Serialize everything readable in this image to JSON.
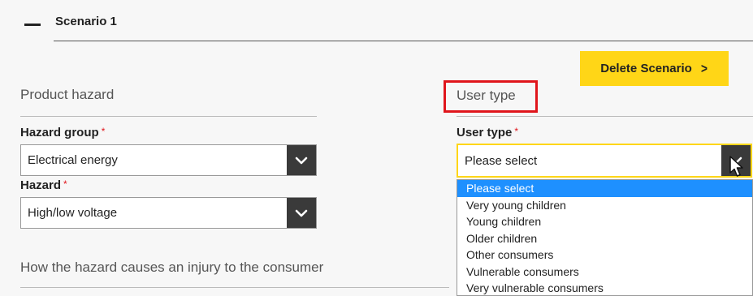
{
  "scenario": {
    "title": "Scenario 1"
  },
  "actions": {
    "delete_label": "Delete Scenario",
    "delete_icon": "chevron-right-icon"
  },
  "product_hazard": {
    "heading": "Product hazard",
    "hazard_group": {
      "label": "Hazard group",
      "required_marker": "*",
      "value": "Electrical energy"
    },
    "hazard": {
      "label": "Hazard",
      "required_marker": "*",
      "value": "High/low voltage"
    }
  },
  "user_type": {
    "heading": "User type",
    "field": {
      "label": "User type",
      "required_marker": "*",
      "value": "Please select"
    },
    "options": [
      "Please select",
      "Very young children",
      "Young children",
      "Older children",
      "Other consumers",
      "Vulnerable consumers",
      "Very vulnerable consumers"
    ],
    "selected_index": 0
  },
  "injury": {
    "heading": "How the hazard causes an injury to the consumer"
  },
  "colors": {
    "accent_yellow": "#ffd617",
    "highlight_red": "#e0151b",
    "selection_blue": "#1e90ff",
    "select_arrow_bg": "#3a3a3a"
  }
}
